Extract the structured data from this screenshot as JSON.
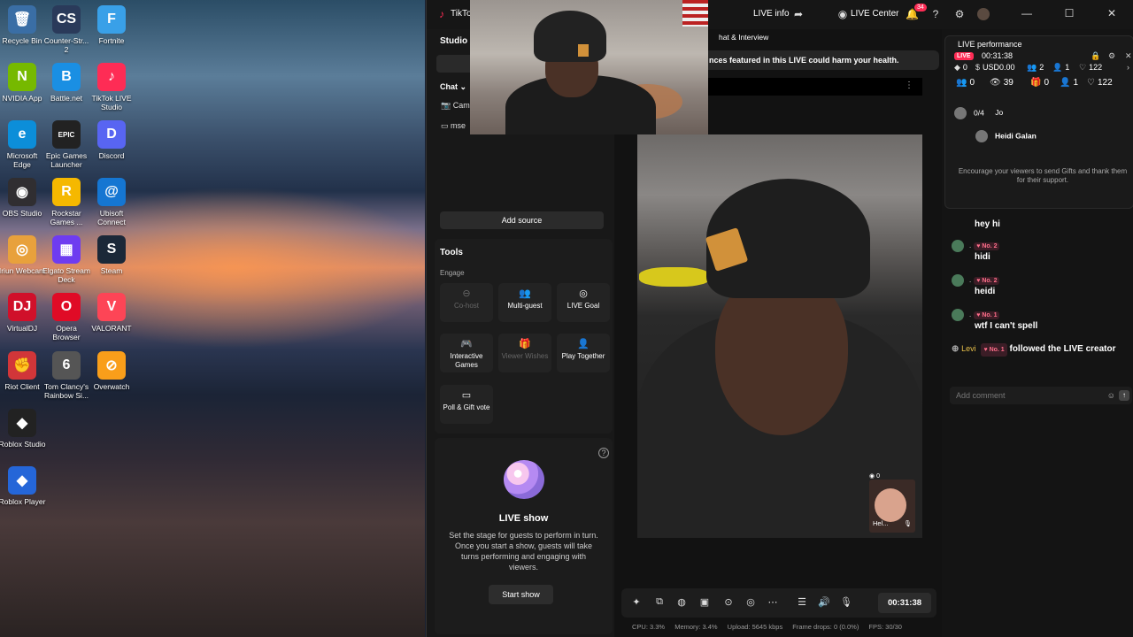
{
  "desktop": {
    "icons": [
      {
        "label": "Recycle Bin",
        "glyph": "🗑",
        "color": "#3a6ea5"
      },
      {
        "label": "Counter-Str... 2",
        "glyph": "CS",
        "color": "#2a3a5a"
      },
      {
        "label": "Fortnite",
        "glyph": "F",
        "color": "#39a0e8"
      },
      {
        "label": "NVIDIA App",
        "glyph": "N",
        "color": "#76b900"
      },
      {
        "label": "Battle.net",
        "glyph": "B",
        "color": "#1a8fe3"
      },
      {
        "label": "TikTok LIVE Studio",
        "glyph": "♪",
        "color": "#fe2c55"
      },
      {
        "label": "Microsoft Edge",
        "glyph": "e",
        "color": "#0c8ed9"
      },
      {
        "label": "Epic Games Launcher",
        "glyph": "EPIC",
        "color": "#222222"
      },
      {
        "label": "Discord",
        "glyph": "D",
        "color": "#5865f2"
      },
      {
        "label": "OBS Studio",
        "glyph": "◉",
        "color": "#302e31"
      },
      {
        "label": "Rockstar Games ...",
        "glyph": "R",
        "color": "#f5b800"
      },
      {
        "label": "Ubisoft Connect",
        "glyph": "@",
        "color": "#1576d2"
      },
      {
        "label": "Iriun Webcam",
        "glyph": "◎",
        "color": "#e8a13c"
      },
      {
        "label": "Elgato Stream Deck",
        "glyph": "▦",
        "color": "#6e3cf0"
      },
      {
        "label": "Steam",
        "glyph": "S",
        "color": "#1b2838"
      },
      {
        "label": "VirtualDJ",
        "glyph": "DJ",
        "color": "#d0102a"
      },
      {
        "label": "Opera Browser",
        "glyph": "O",
        "color": "#e00b26"
      },
      {
        "label": "VALORANT",
        "glyph": "V",
        "color": "#fd4556"
      },
      {
        "label": "Riot Client",
        "glyph": "✊",
        "color": "#d13639"
      },
      {
        "label": "Tom Clancy's Rainbow Si...",
        "glyph": "6",
        "color": "#555555"
      },
      {
        "label": "Overwatch",
        "glyph": "⊘",
        "color": "#f99e1a"
      },
      {
        "label": "Roblox Studio",
        "glyph": "◆",
        "color": "#222222"
      },
      {
        "label": "Roblox Player",
        "glyph": "◆",
        "color": "#2566d8"
      }
    ]
  },
  "app": {
    "title": "TikTo",
    "live_info": "LIVE info",
    "live_center": "LIVE Center",
    "notification_count": "34"
  },
  "left": {
    "studio_title": "Studio",
    "chat_label": "Chat",
    "sources": [
      "Cam",
      "mse"
    ],
    "add_source": "Add source",
    "tools_title": "Tools",
    "engage_title": "Engage",
    "tools": [
      {
        "label": "Co-host",
        "glyph": "⊖",
        "disabled": true
      },
      {
        "label": "Multi-guest",
        "glyph": "👥",
        "disabled": false
      },
      {
        "label": "LIVE Goal",
        "glyph": "◎",
        "disabled": false
      },
      {
        "label": "Interactive Games",
        "glyph": "🎮",
        "disabled": false
      },
      {
        "label": "Viewer Wishes",
        "glyph": "🎁",
        "disabled": true
      },
      {
        "label": "Play Together",
        "glyph": "👤",
        "disabled": false
      },
      {
        "label": "Poll & Gift vote",
        "glyph": "▭",
        "disabled": false
      }
    ],
    "show_title": "LIVE show",
    "show_desc": "Set the stage for guests to perform in turn. Once you start a show, guests will take turns performing and engaging with viewers.",
    "start_show": "Start show"
  },
  "center": {
    "banner": "hat & Interview",
    "warning": "nces featured in this LIVE could harm your health.",
    "guest_count": "0",
    "guest_name": "Hel...",
    "timer": "00:31:38",
    "stats": {
      "cpu": "CPU:  3.3%",
      "memory": "Memory:  3.4%",
      "upload": "Upload:  5645 kbps",
      "frame_drops": "Frame drops:  0 (0.0%)",
      "fps": "FPS:  30/30"
    }
  },
  "right": {
    "perf_title": "LIVE performance",
    "live_badge": "LIVE",
    "elapsed": "00:31:38",
    "row1": {
      "coins": "0",
      "usd": "USD0.00",
      "viewers": "2",
      "new_followers": "1",
      "likes": "122"
    },
    "row2": {
      "gifters": "0",
      "views": "39",
      "gifts": "0",
      "follows": "1",
      "hearts": "122"
    },
    "viewer_slots": "0/4",
    "viewers": [
      "Jo",
      "Heidi Galan"
    ],
    "encourage": "Encourage your viewers to send Gifts and thank them for their support.",
    "messages": [
      {
        "user": "",
        "rank": "",
        "text": "hey hi"
      },
      {
        "user": ".",
        "rank": "No. 2",
        "text": "hidi"
      },
      {
        "user": ".",
        "rank": "No. 2",
        "text": "heidi"
      },
      {
        "user": ".",
        "rank": "No. 1",
        "text": "wtf I can't spell"
      }
    ],
    "follow": {
      "name": "Levi",
      "rank": "No. 1",
      "text": "followed the LIVE creator"
    },
    "comment_placeholder": "Add comment"
  }
}
